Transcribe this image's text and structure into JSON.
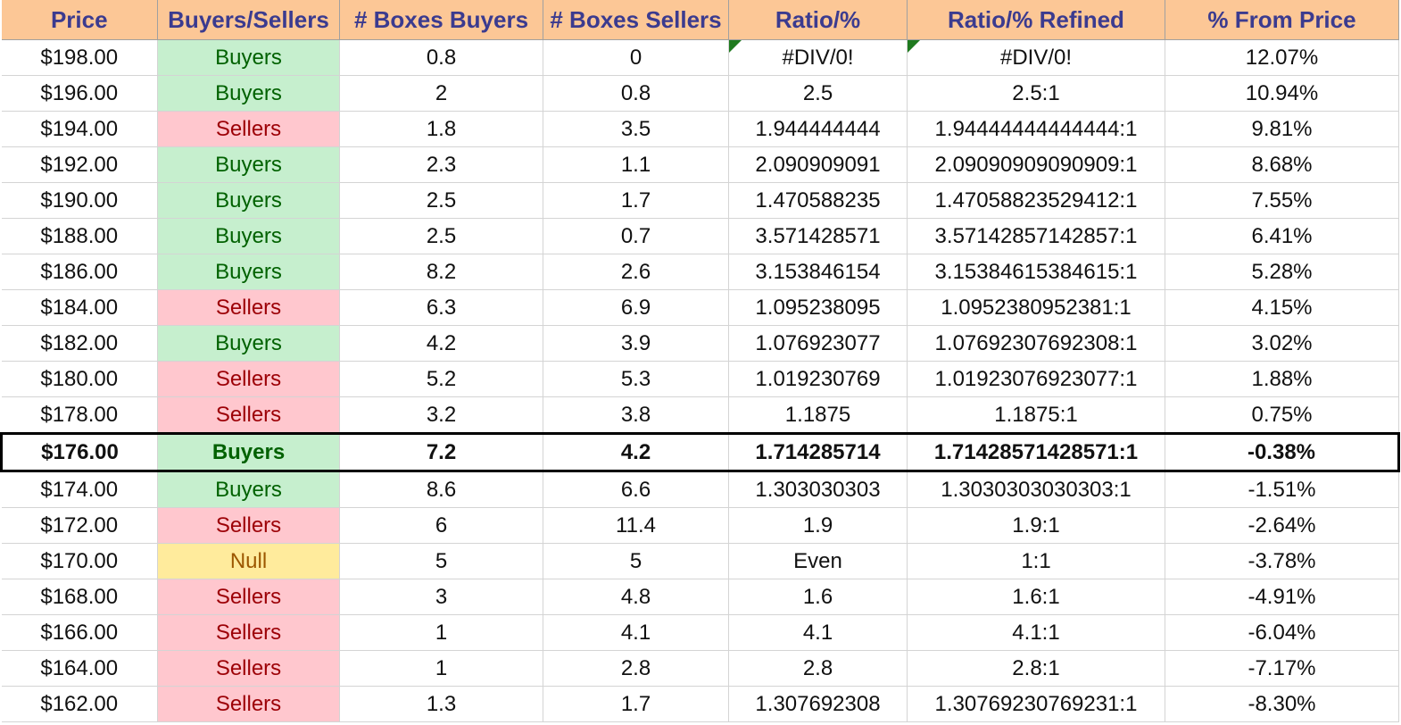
{
  "columns": [
    "Price",
    "Buyers/Sellers",
    "# Boxes Buyers",
    "# Boxes Sellers",
    "Ratio/%",
    "Ratio/% Refined",
    "% From Price"
  ],
  "rows": [
    {
      "price": "$198.00",
      "side": "Buyers",
      "boxes_buyers": "0.8",
      "boxes_sellers": "0",
      "ratio": "#DIV/0!",
      "ratio_refined": "#DIV/0!",
      "from_price": "12.07%"
    },
    {
      "price": "$196.00",
      "side": "Buyers",
      "boxes_buyers": "2",
      "boxes_sellers": "0.8",
      "ratio": "2.5",
      "ratio_refined": "2.5:1",
      "from_price": "10.94%"
    },
    {
      "price": "$194.00",
      "side": "Sellers",
      "boxes_buyers": "1.8",
      "boxes_sellers": "3.5",
      "ratio": "1.944444444",
      "ratio_refined": "1.94444444444444:1",
      "from_price": "9.81%"
    },
    {
      "price": "$192.00",
      "side": "Buyers",
      "boxes_buyers": "2.3",
      "boxes_sellers": "1.1",
      "ratio": "2.090909091",
      "ratio_refined": "2.09090909090909:1",
      "from_price": "8.68%"
    },
    {
      "price": "$190.00",
      "side": "Buyers",
      "boxes_buyers": "2.5",
      "boxes_sellers": "1.7",
      "ratio": "1.470588235",
      "ratio_refined": "1.47058823529412:1",
      "from_price": "7.55%"
    },
    {
      "price": "$188.00",
      "side": "Buyers",
      "boxes_buyers": "2.5",
      "boxes_sellers": "0.7",
      "ratio": "3.571428571",
      "ratio_refined": "3.57142857142857:1",
      "from_price": "6.41%"
    },
    {
      "price": "$186.00",
      "side": "Buyers",
      "boxes_buyers": "8.2",
      "boxes_sellers": "2.6",
      "ratio": "3.153846154",
      "ratio_refined": "3.15384615384615:1",
      "from_price": "5.28%"
    },
    {
      "price": "$184.00",
      "side": "Sellers",
      "boxes_buyers": "6.3",
      "boxes_sellers": "6.9",
      "ratio": "1.095238095",
      "ratio_refined": "1.0952380952381:1",
      "from_price": "4.15%"
    },
    {
      "price": "$182.00",
      "side": "Buyers",
      "boxes_buyers": "4.2",
      "boxes_sellers": "3.9",
      "ratio": "1.076923077",
      "ratio_refined": "1.07692307692308:1",
      "from_price": "3.02%"
    },
    {
      "price": "$180.00",
      "side": "Sellers",
      "boxes_buyers": "5.2",
      "boxes_sellers": "5.3",
      "ratio": "1.019230769",
      "ratio_refined": "1.01923076923077:1",
      "from_price": "1.88%"
    },
    {
      "price": "$178.00",
      "side": "Sellers",
      "boxes_buyers": "3.2",
      "boxes_sellers": "3.8",
      "ratio": "1.1875",
      "ratio_refined": "1.1875:1",
      "from_price": "0.75%"
    },
    {
      "price": "$176.00",
      "side": "Buyers",
      "boxes_buyers": "7.2",
      "boxes_sellers": "4.2",
      "ratio": "1.714285714",
      "ratio_refined": "1.71428571428571:1",
      "from_price": "-0.38%"
    },
    {
      "price": "$174.00",
      "side": "Buyers",
      "boxes_buyers": "8.6",
      "boxes_sellers": "6.6",
      "ratio": "1.303030303",
      "ratio_refined": "1.3030303030303:1",
      "from_price": "-1.51%"
    },
    {
      "price": "$172.00",
      "side": "Sellers",
      "boxes_buyers": "6",
      "boxes_sellers": "11.4",
      "ratio": "1.9",
      "ratio_refined": "1.9:1",
      "from_price": "-2.64%"
    },
    {
      "price": "$170.00",
      "side": "Null",
      "boxes_buyers": "5",
      "boxes_sellers": "5",
      "ratio": "Even",
      "ratio_refined": "1:1",
      "from_price": "-3.78%"
    },
    {
      "price": "$168.00",
      "side": "Sellers",
      "boxes_buyers": "3",
      "boxes_sellers": "4.8",
      "ratio": "1.6",
      "ratio_refined": "1.6:1",
      "from_price": "-4.91%"
    },
    {
      "price": "$166.00",
      "side": "Sellers",
      "boxes_buyers": "1",
      "boxes_sellers": "4.1",
      "ratio": "4.1",
      "ratio_refined": "4.1:1",
      "from_price": "-6.04%"
    },
    {
      "price": "$164.00",
      "side": "Sellers",
      "boxes_buyers": "1",
      "boxes_sellers": "2.8",
      "ratio": "2.8",
      "ratio_refined": "2.8:1",
      "from_price": "-7.17%"
    },
    {
      "price": "$162.00",
      "side": "Sellers",
      "boxes_buyers": "1.3",
      "boxes_sellers": "1.7",
      "ratio": "1.307692308",
      "ratio_refined": "1.30769230769231:1",
      "from_price": "-8.30%"
    }
  ],
  "current_row_index": 11,
  "comment_flag_cells": [
    "0.ratio",
    "0.ratio_refined"
  ],
  "colors": {
    "header_bg": "#fcc796",
    "header_text": "#3b3b8f",
    "buyers_bg": "#c6efce",
    "buyers_text": "#006100",
    "sellers_bg": "#ffc7ce",
    "sellers_text": "#9c0006",
    "null_bg": "#ffeb9c",
    "null_text": "#9c5700",
    "comment_flag": "#1f7a1f"
  }
}
